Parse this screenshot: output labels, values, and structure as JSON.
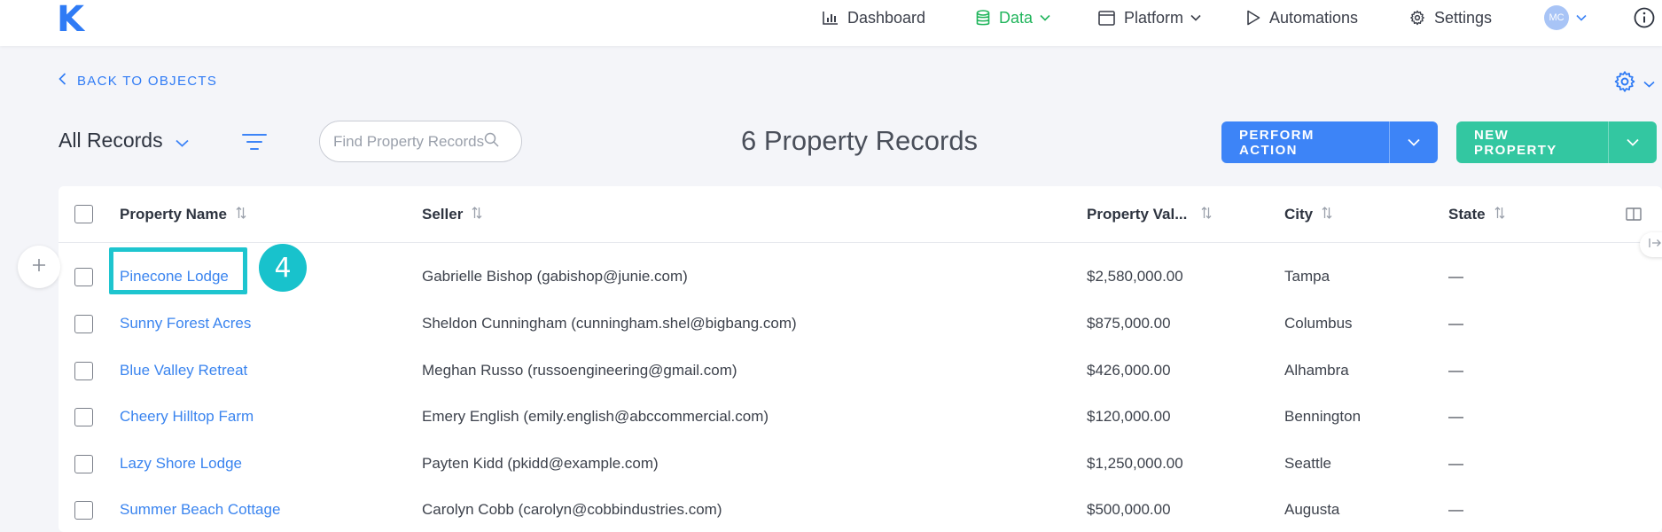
{
  "app": {
    "logo_letter": "K"
  },
  "nav": {
    "items": [
      {
        "label": "Dashboard",
        "icon": "bar-chart-icon"
      },
      {
        "label": "Data",
        "icon": "database-icon",
        "active": true,
        "has_dropdown": true
      },
      {
        "label": "Platform",
        "icon": "window-icon",
        "has_dropdown": true
      },
      {
        "label": "Automations",
        "icon": "play-icon"
      },
      {
        "label": "Settings",
        "icon": "gear-icon"
      }
    ],
    "avatar_initials": "MC",
    "info_icon": "info-icon"
  },
  "subheader": {
    "back_label": "BACK TO OBJECTS",
    "view_label": "All Records",
    "search_placeholder": "Find Property Records",
    "records_count_text": "6 Property Records"
  },
  "buttons": {
    "perform_action": "PERFORM ACTION",
    "new_property": "NEW PROPERTY"
  },
  "table": {
    "columns": [
      {
        "label": "Property Name"
      },
      {
        "label": "Seller"
      },
      {
        "label": "Property Val..."
      },
      {
        "label": "City"
      },
      {
        "label": "State"
      }
    ],
    "rows": [
      {
        "name": "Pinecone Lodge",
        "seller": "Gabrielle Bishop (gabishop@junie.com)",
        "value": "$2,580,000.00",
        "city": "Tampa",
        "state": "—"
      },
      {
        "name": "Sunny Forest Acres",
        "seller": "Sheldon Cunningham (cunningham.shel@bigbang.com)",
        "value": "$875,000.00",
        "city": "Columbus",
        "state": "—"
      },
      {
        "name": "Blue Valley Retreat",
        "seller": "Meghan Russo (russoengineering@gmail.com)",
        "value": "$426,000.00",
        "city": "Alhambra",
        "state": "—"
      },
      {
        "name": "Cheery Hilltop Farm",
        "seller": "Emery English (emily.english@abccommercial.com)",
        "value": "$120,000.00",
        "city": "Bennington",
        "state": "—"
      },
      {
        "name": "Lazy Shore Lodge",
        "seller": "Payten Kidd (pkidd@example.com)",
        "value": "$1,250,000.00",
        "city": "Seattle",
        "state": "—"
      },
      {
        "name": "Summer Beach Cottage",
        "seller": "Carolyn Cobb (carolyn@cobbindustries.com)",
        "value": "$500,000.00",
        "city": "Augusta",
        "state": "—"
      }
    ]
  },
  "annotation": {
    "step_number": "4"
  },
  "colors": {
    "brand_blue": "#2f7bf5",
    "active_green": "#21b55c",
    "perform_action_bg": "#3d84f7",
    "new_property_bg": "#33c7a1",
    "highlight_teal": "#1ec5cf"
  }
}
